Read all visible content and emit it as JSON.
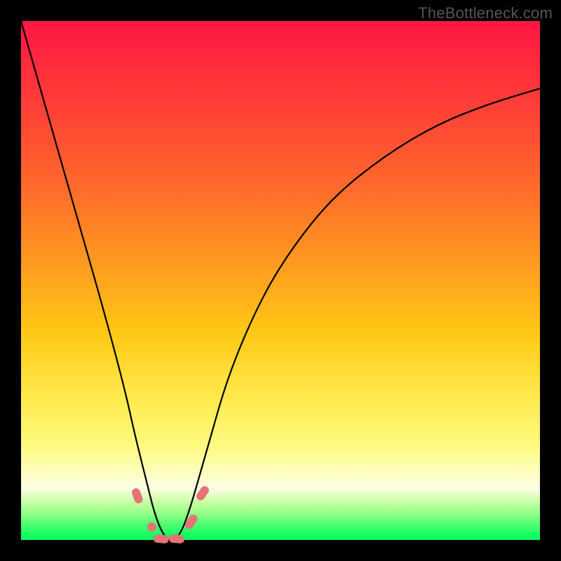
{
  "watermark": "TheBottleneck.com",
  "chart_data": {
    "type": "line",
    "title": "",
    "xlabel": "",
    "ylabel": "",
    "xlim": [
      0,
      1
    ],
    "ylim": [
      0,
      1
    ],
    "series": [
      {
        "name": "bottleneck-curve",
        "x": [
          0.0,
          0.04,
          0.08,
          0.12,
          0.16,
          0.2,
          0.22,
          0.24,
          0.26,
          0.28,
          0.3,
          0.32,
          0.36,
          0.4,
          0.46,
          0.52,
          0.6,
          0.7,
          0.8,
          0.9,
          1.0
        ],
        "y": [
          1.0,
          0.86,
          0.72,
          0.58,
          0.44,
          0.29,
          0.2,
          0.12,
          0.04,
          0.0,
          0.0,
          0.04,
          0.18,
          0.32,
          0.46,
          0.56,
          0.66,
          0.74,
          0.8,
          0.84,
          0.87
        ]
      }
    ],
    "markers": [
      {
        "x": 0.224,
        "y": 0.085,
        "shape": "pill-steep"
      },
      {
        "x": 0.252,
        "y": 0.025,
        "shape": "dot"
      },
      {
        "x": 0.27,
        "y": 0.002,
        "shape": "pill-flat"
      },
      {
        "x": 0.3,
        "y": 0.002,
        "shape": "pill-flat"
      },
      {
        "x": 0.328,
        "y": 0.035,
        "shape": "pill-rise"
      },
      {
        "x": 0.35,
        "y": 0.09,
        "shape": "pill-rise"
      }
    ],
    "background_gradient": {
      "top": "#ff1744",
      "mid": "#ffe94a",
      "bottom": "#00ff5c"
    }
  }
}
